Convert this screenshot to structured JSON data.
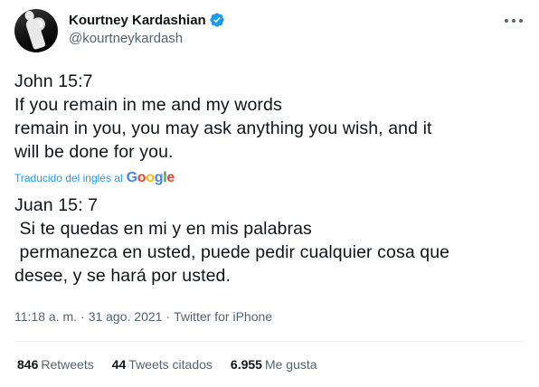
{
  "author": {
    "display_name": "Kourtney Kardashian",
    "handle": "@kourtneykardash",
    "verified": true,
    "verified_icon": "verified-badge-icon"
  },
  "menu_icon": "more-options-icon",
  "tweet": {
    "original_text": "John 15:7\nIf you remain in me and my words\nremain in you, you may ask anything you wish, and it\nwill be done for you.",
    "translation_label": "Traducido del inglés al",
    "translation_provider": "Google",
    "translated_text": "Juan 15: 7\n Si te quedas en mi y en mis palabras\n permanezca en usted, puede pedir cualquier cosa que\ndesee, y se hará por usted."
  },
  "meta": {
    "time": "11:18 a. m.",
    "separator1": "·",
    "date": "31 ago. 2021",
    "separator2": "·",
    "source": "Twitter for iPhone"
  },
  "stats": {
    "retweets_count": "846",
    "retweets_label": "Retweets",
    "quotes_count": "44",
    "quotes_label": "Tweets citados",
    "likes_count": "6.955",
    "likes_label": "Me gusta"
  },
  "colors": {
    "accent": "#1d9bf0",
    "secondary_text": "#536471",
    "primary_text": "#0f1419"
  }
}
